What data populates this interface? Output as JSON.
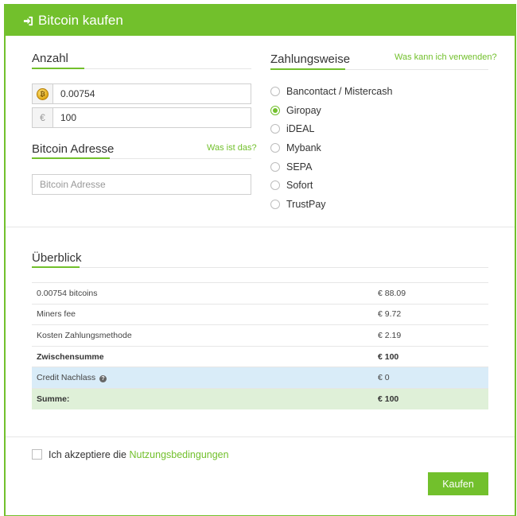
{
  "header": {
    "title": "Bitcoin kaufen",
    "icon": "sign-in-icon"
  },
  "amount": {
    "title": "Anzahl",
    "btc_value": "0.00754",
    "eur_symbol": "€",
    "eur_value": "100"
  },
  "address": {
    "title": "Bitcoin Adresse",
    "help_link": "Was ist das?",
    "placeholder": "Bitcoin Adresse"
  },
  "payment": {
    "title": "Zahlungsweise",
    "help_link": "Was kann ich verwenden?",
    "selected": "Giropay",
    "options": [
      "Bancontact / Mistercash",
      "Giropay",
      "iDEAL",
      "Mybank",
      "SEPA",
      "Sofort",
      "TrustPay"
    ]
  },
  "overview": {
    "title": "Überblick",
    "rows": [
      {
        "label": "0.00754 bitcoins",
        "value": "€ 88.09"
      },
      {
        "label": "Miners fee",
        "value": "€ 9.72"
      },
      {
        "label": "Kosten Zahlungsmethode",
        "value": "€ 2.19"
      },
      {
        "label": "Zwischensumme",
        "value": "€ 100"
      },
      {
        "label": "Credit Nachlass",
        "value": "€ 0"
      },
      {
        "label": "Summe:",
        "value": "€ 100"
      }
    ]
  },
  "terms": {
    "prefix": "Ich akzeptiere die",
    "link": "Nutzungsbedingungen"
  },
  "submit": {
    "label": "Kaufen"
  },
  "colors": {
    "accent": "#72c02c",
    "credit_row": "#d9ecf8",
    "total_row": "#dff0d8"
  }
}
